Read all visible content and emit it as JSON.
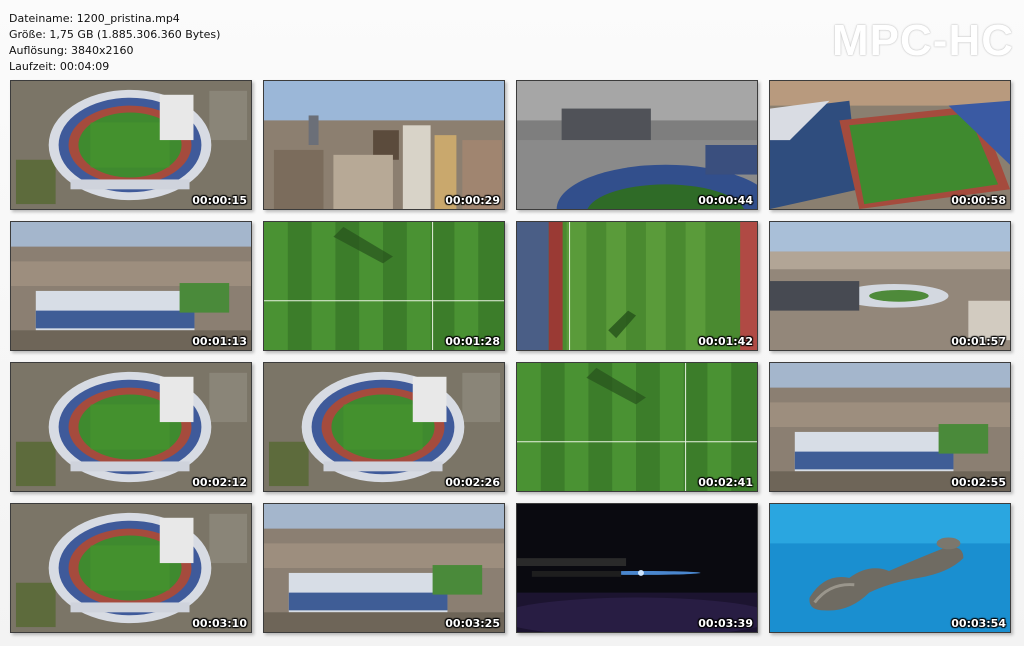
{
  "file_info": {
    "filename": "Dateiname: 1200_pristina.mp4",
    "size": "Größe: 1,75 GB (1.885.306.360 Bytes)",
    "resolution": "Auflösung: 3840x2160",
    "duration": "Laufzeit: 00:04:09"
  },
  "logo": "MPC-HC",
  "thumbnails": [
    {
      "timestamp": "00:00:15",
      "scene": "stadium-aerial"
    },
    {
      "timestamp": "00:00:29",
      "scene": "city-skyline"
    },
    {
      "timestamp": "00:00:44",
      "scene": "stadium-stand-top"
    },
    {
      "timestamp": "00:00:58",
      "scene": "stadium-pitch-side"
    },
    {
      "timestamp": "00:01:13",
      "scene": "stadium-city"
    },
    {
      "timestamp": "00:01:28",
      "scene": "pitch-grass"
    },
    {
      "timestamp": "00:01:42",
      "scene": "pitch-grass-edge"
    },
    {
      "timestamp": "00:01:57",
      "scene": "city-panorama"
    },
    {
      "timestamp": "00:02:12",
      "scene": "stadium-aerial"
    },
    {
      "timestamp": "00:02:26",
      "scene": "stadium-aerial"
    },
    {
      "timestamp": "00:02:41",
      "scene": "pitch-grass"
    },
    {
      "timestamp": "00:02:55",
      "scene": "stadium-city"
    },
    {
      "timestamp": "00:03:10",
      "scene": "stadium-aerial"
    },
    {
      "timestamp": "00:03:25",
      "scene": "stadium-city"
    },
    {
      "timestamp": "00:03:39",
      "scene": "space-title"
    },
    {
      "timestamp": "00:03:54",
      "scene": "island-sea"
    }
  ]
}
